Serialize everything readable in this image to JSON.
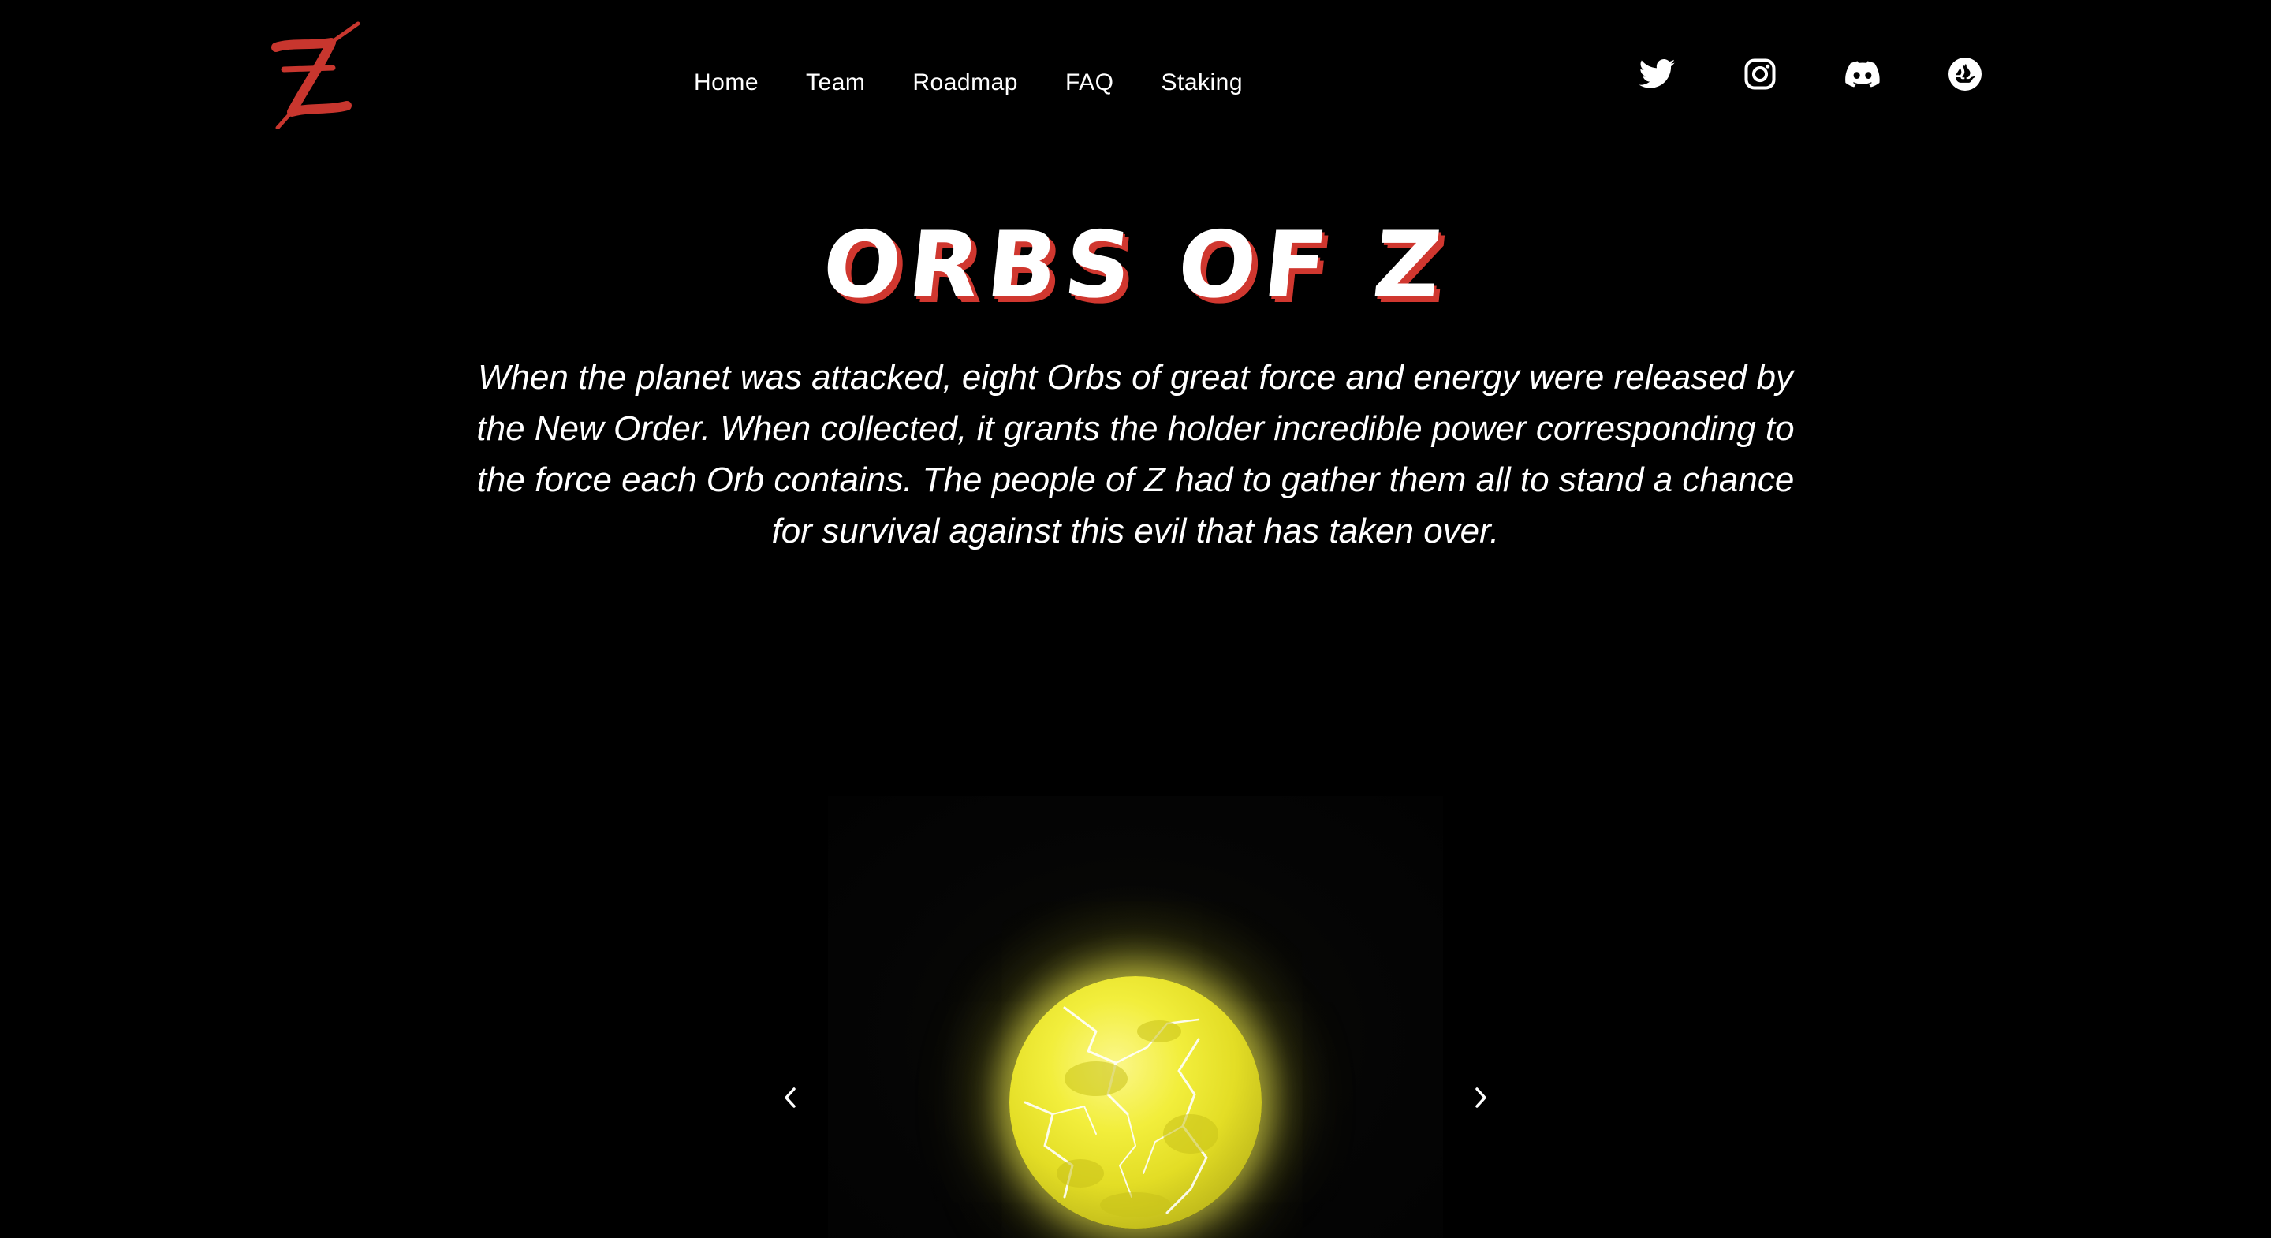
{
  "header": {
    "logo_alt": "Z",
    "logo_color": "#c8362e",
    "nav": [
      {
        "label": "Home"
      },
      {
        "label": "Team"
      },
      {
        "label": "Roadmap"
      },
      {
        "label": "FAQ"
      },
      {
        "label": "Staking"
      }
    ],
    "socials": [
      {
        "icon": "twitter-icon"
      },
      {
        "icon": "instagram-icon"
      },
      {
        "icon": "discord-icon"
      },
      {
        "icon": "opensea-icon"
      }
    ]
  },
  "hero": {
    "title": "ORBS OF Z",
    "title_shadow_color": "#d0372f",
    "description": "When the planet was attacked, eight Orbs of great force and energy were released by the New Order. When collected, it grants the holder incredible power corresponding to the force each Orb contains. The people of Z had to gather them all to stand a chance for survival against this evil that has taken over."
  },
  "carousel": {
    "orb_color": "#f2ee3c",
    "prev_icon": "chevron-left-icon",
    "next_icon": "chevron-right-icon"
  }
}
